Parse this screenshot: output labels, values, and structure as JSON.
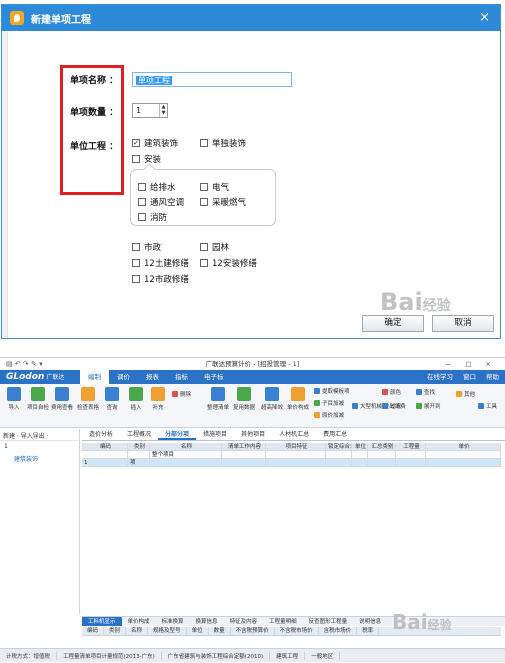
{
  "dialog": {
    "title": "新建单项工程",
    "close_glyph": "×",
    "labels": {
      "name": "单项名称 ：",
      "quantity": "单项数量 ：",
      "unit": "单位工程 ："
    },
    "name_value": "单项工程",
    "quantity_value": "1",
    "spin_up": "▲",
    "spin_down": "▼",
    "checkboxes": {
      "jianzhu": {
        "label": "建筑装饰",
        "checked": true
      },
      "dandu": {
        "label": "单独装饰",
        "checked": false
      },
      "anzhuang": {
        "label": "安装",
        "checked": false
      },
      "geipaishui": {
        "label": "给排水",
        "checked": false
      },
      "dianqi": {
        "label": "电气",
        "checked": false
      },
      "tongfeng": {
        "label": "通风空调",
        "checked": false
      },
      "cainuan": {
        "label": "采暖燃气",
        "checked": false
      },
      "xiaofang": {
        "label": "消防",
        "checked": false
      },
      "shizheng": {
        "label": "市政",
        "checked": false
      },
      "yuanlin": {
        "label": "园林",
        "checked": false
      },
      "tujian12": {
        "label": "12土建修缮",
        "checked": false
      },
      "anzhuang12": {
        "label": "12安装修缮",
        "checked": false
      },
      "shizheng12": {
        "label": "12市政修缮",
        "checked": false
      }
    },
    "check_mark": "✓",
    "buttons": {
      "ok": "确定",
      "cancel": "取消"
    }
  },
  "watermark": {
    "text": "Bai",
    "suffix": "经验"
  },
  "app": {
    "title": "广联达预算计价 - [招投管理 - 1]",
    "quick_access": "▤ ↶ ↷ ✎ ▾",
    "window_controls": "— □ ×",
    "logo": "GLodon",
    "logo_sub": "广联达",
    "ribbon_tabs": [
      "编制",
      "调价",
      "报表",
      "指标",
      "电子标"
    ],
    "active_ribbon_tab": "编制",
    "ribbon_right": [
      "在线学习",
      "窗口",
      "帮助"
    ],
    "ribbon_buttons": [
      "导入",
      "项目自检",
      "费用查看",
      "检查表格",
      "查询",
      "插入",
      "补充",
      "删除",
      "整理清单",
      "复用数据",
      "超高降效",
      "单价构成"
    ],
    "ribbon_small": [
      "提取模板项",
      "子目加减",
      "原价加减",
      "大型机械 进出场费",
      "颜色",
      "过滤",
      "查找",
      "展开到",
      "其他",
      "工具"
    ],
    "ribbon_colors": {
      "blue": "#3a7fd0",
      "orange": "#f0a030",
      "green": "#4aa84a",
      "red": "#d9534f"
    },
    "tree_header": "新建 · 导入导出 ·",
    "tree_root": "1",
    "tree_child": "建筑装饰",
    "doc_tabs": [
      "造价分析",
      "工程概况",
      "分部分项",
      "措施项目",
      "其他项目",
      "人材机汇总",
      "费用汇总"
    ],
    "active_doc_tab": "分部分项",
    "grid_headers": [
      "编码",
      "类别",
      "名称",
      "清单工作内容",
      "项目特征",
      "锁定综合单价",
      "单位",
      "汇总类别",
      "工程量",
      "单价"
    ],
    "grid_rows": [
      [
        "",
        "",
        "整个项目",
        "",
        "",
        "",
        "",
        "",
        "",
        ""
      ],
      [
        "1",
        "项",
        "",
        "",
        "",
        "",
        "",
        "",
        "",
        ""
      ]
    ],
    "bottom_tabs": [
      "工料机显示",
      "单价构成",
      "标准换算",
      "换算信息",
      "特征及内容",
      "工程量明细",
      "反查图形工程量",
      "说明信息"
    ],
    "active_bottom_tab": "工料机显示",
    "bottom_grid_headers": [
      "编码",
      "类别",
      "名称",
      "规格及型号",
      "单位",
      "数量",
      "不含税预算价",
      "不含税市场价",
      "含税市场价",
      "税率"
    ],
    "status": [
      "计税方式：增值税",
      "工程量清单项目计量规范(2013-广东)",
      "广东省建筑与装饰工程综合定额(2010)",
      "建筑工程",
      "一般地区"
    ]
  }
}
